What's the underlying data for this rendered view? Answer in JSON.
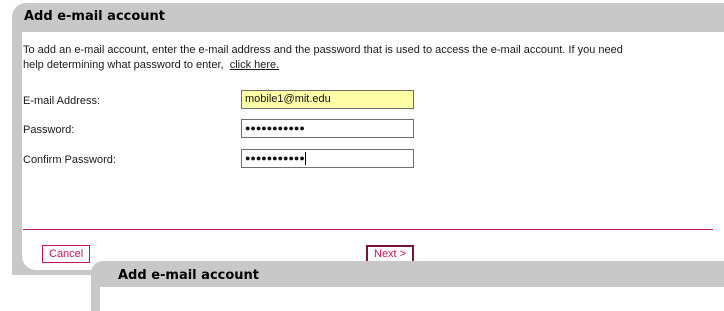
{
  "dialog": {
    "title": "Add e-mail account",
    "intro_text": "To add an e-mail account, enter the e-mail address and the password that is used to access the e-mail account. If you need help determining what password to enter,",
    "help_link": "click here.",
    "fields": {
      "email": {
        "label": "E-mail Address:",
        "value": "mobile1@mit.edu"
      },
      "password": {
        "label": "Password:",
        "value": "●●●●●●●●●●●"
      },
      "confirm": {
        "label": "Confirm Password:",
        "value": "●●●●●●●●●●●"
      }
    },
    "cancel_label": "Cancel",
    "next_label": "Next >"
  },
  "second_dialog": {
    "title": "Add e-mail account"
  },
  "colors": {
    "accent": "#c2185b",
    "panel": "#c8c8c8",
    "active_field": "#ffffa8"
  }
}
